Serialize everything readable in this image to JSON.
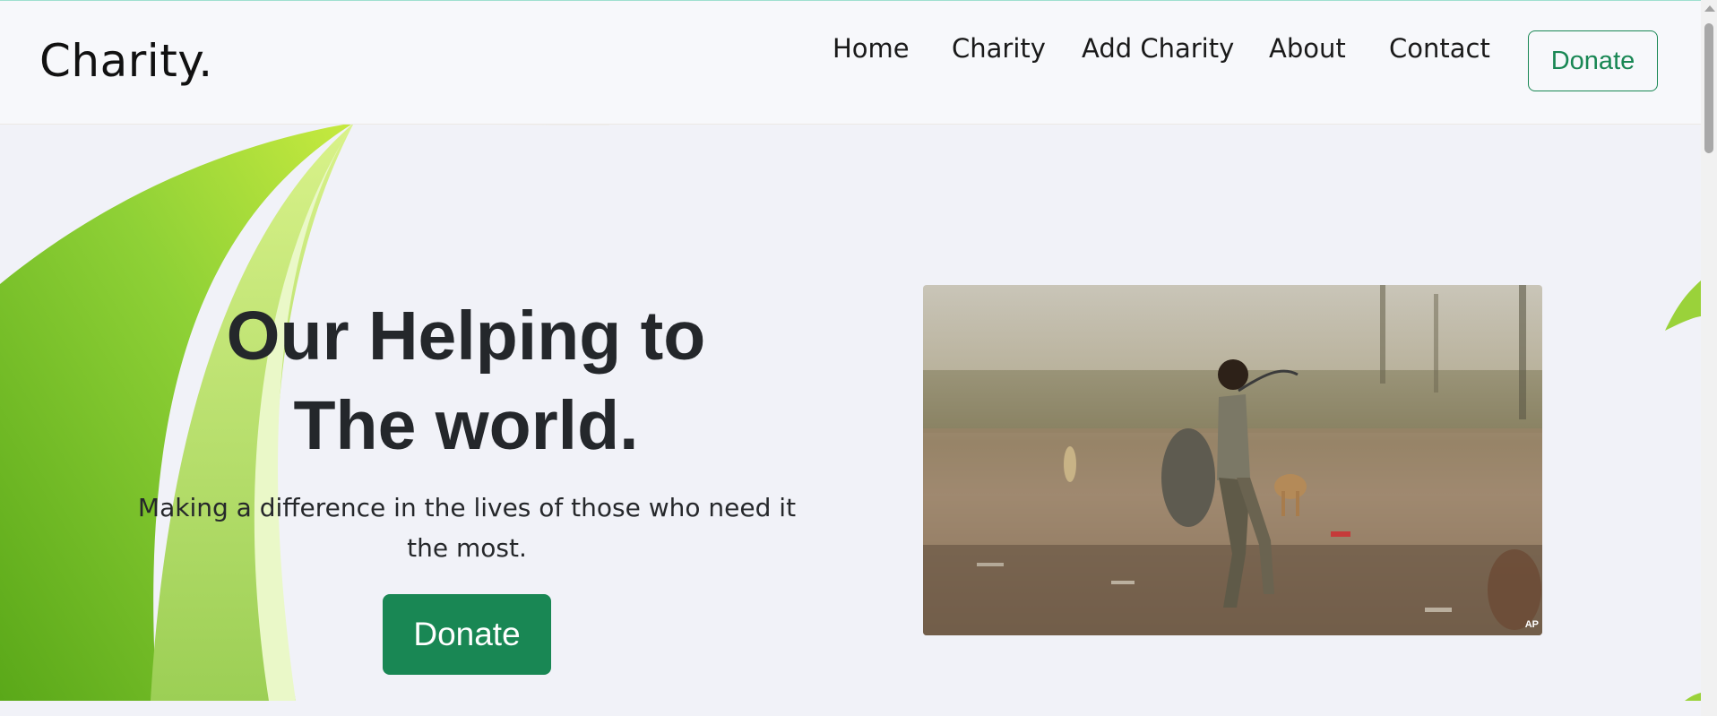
{
  "brand": {
    "name": "Charity."
  },
  "nav": {
    "links": [
      "Home",
      "Charity",
      "Add Charity",
      "About",
      "Contact"
    ],
    "donate_label": "Donate"
  },
  "hero": {
    "headline_line1": "Our Helping to",
    "headline_line2": "The world.",
    "subtitle": "Making a difference in the lives of those who need it the most.",
    "donate_label": "Donate",
    "photo_credit": "AP"
  },
  "colors": {
    "accent": "#198754",
    "leaf_green": "#6fbf2a",
    "leaf_light": "#cde97a",
    "background": "#f1f2f8"
  }
}
